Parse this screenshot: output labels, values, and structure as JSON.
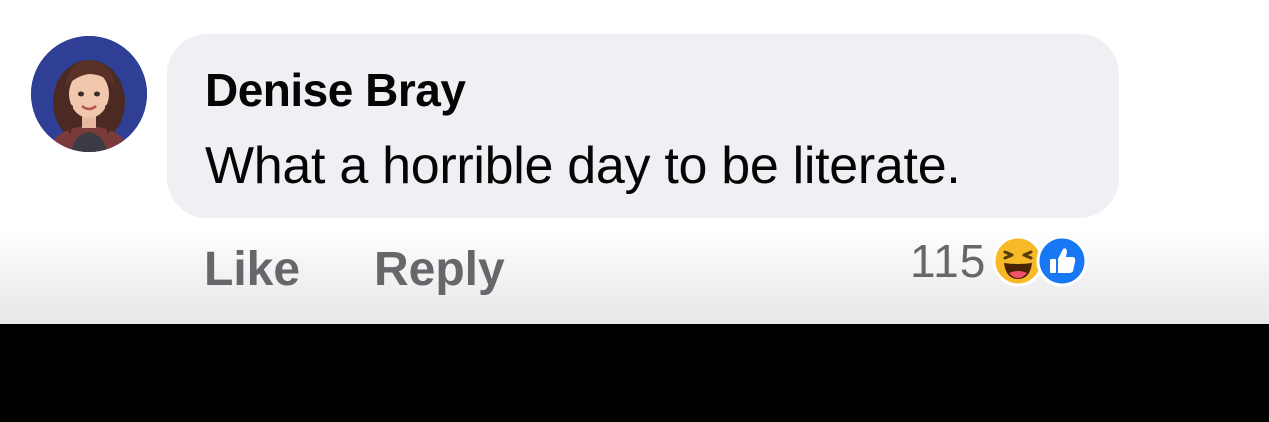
{
  "comment": {
    "author": "Denise Bray",
    "text": "What a horrible day to be literate."
  },
  "actions": {
    "like_label": "Like",
    "reply_label": "Reply"
  },
  "reactions": {
    "count": "115",
    "icons": [
      "haha-icon",
      "like-icon"
    ]
  },
  "colors": {
    "bubble": "#eff0f3",
    "text": "#050505",
    "secondary_text": "#65676b",
    "like_blue": "#1877f2",
    "haha_yellow": "#f7b928"
  }
}
